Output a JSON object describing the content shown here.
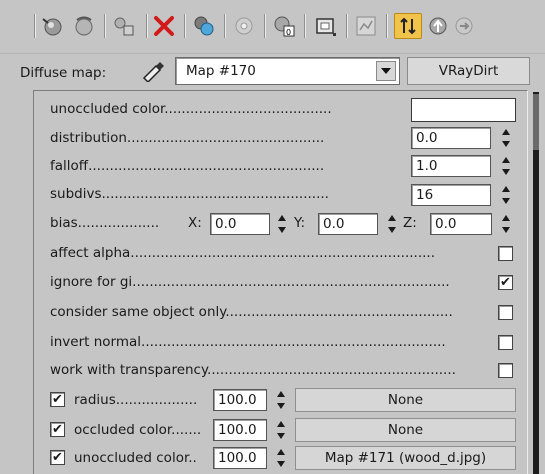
{
  "toolbar": {
    "icons": [
      "get-material-icon",
      "put-to-scene-icon",
      "assign-material-icon",
      "delete-icon",
      "make-unique-icon",
      "put-to-library-icon",
      "material-effects-channel-icon",
      "show-in-viewport-icon",
      "show-end-result-icon",
      "go-to-parent-icon",
      "go-forward-icon"
    ]
  },
  "diffuse": {
    "label": "Diffuse map:",
    "map_name": "Map #170",
    "map_type": "VRayDirt"
  },
  "params": {
    "unoccluded_color_label": "unoccluded color.......................................",
    "distribution_label": "distribution..............................................",
    "distribution_value": "0.0",
    "falloff_label": "falloff.......................................................",
    "falloff_value": "1.0",
    "subdivs_label": "subdivs.....................................................",
    "subdivs_value": "16",
    "bias_label": "bias...................",
    "bias_x_label": "X:",
    "bias_x": "0.0",
    "bias_y_label": "Y:",
    "bias_y": "0.0",
    "bias_z_label": "Z:",
    "bias_z": "0.0",
    "affect_alpha_label": "affect alpha.......................................................................",
    "ignore_gi_label": "ignore for gi..........................................................................",
    "consider_same_label": "consider same object only.....................................................",
    "invert_normal_label": "invert normal.......................................................................",
    "work_transparency_label": "work with transparency..........................................................",
    "radius_label": "radius...................",
    "radius_value": "100.0",
    "radius_map": "None",
    "occluded_color_label": "occluded color.......",
    "occluded_color_value": "100.0",
    "occluded_color_map": "None",
    "unoccluded_color_map_label": "unoccluded color..",
    "unoccluded_color_map_value": "100.0",
    "unoccluded_color_map": "Map #171 (wood_d.jpg)"
  },
  "checks": {
    "affect_alpha": "",
    "ignore_gi": "✔",
    "consider_same": "",
    "invert_normal": "",
    "work_transparency": "",
    "radius_enabled": "✔",
    "occluded_enabled": "✔",
    "unoccluded_enabled": "✔"
  }
}
